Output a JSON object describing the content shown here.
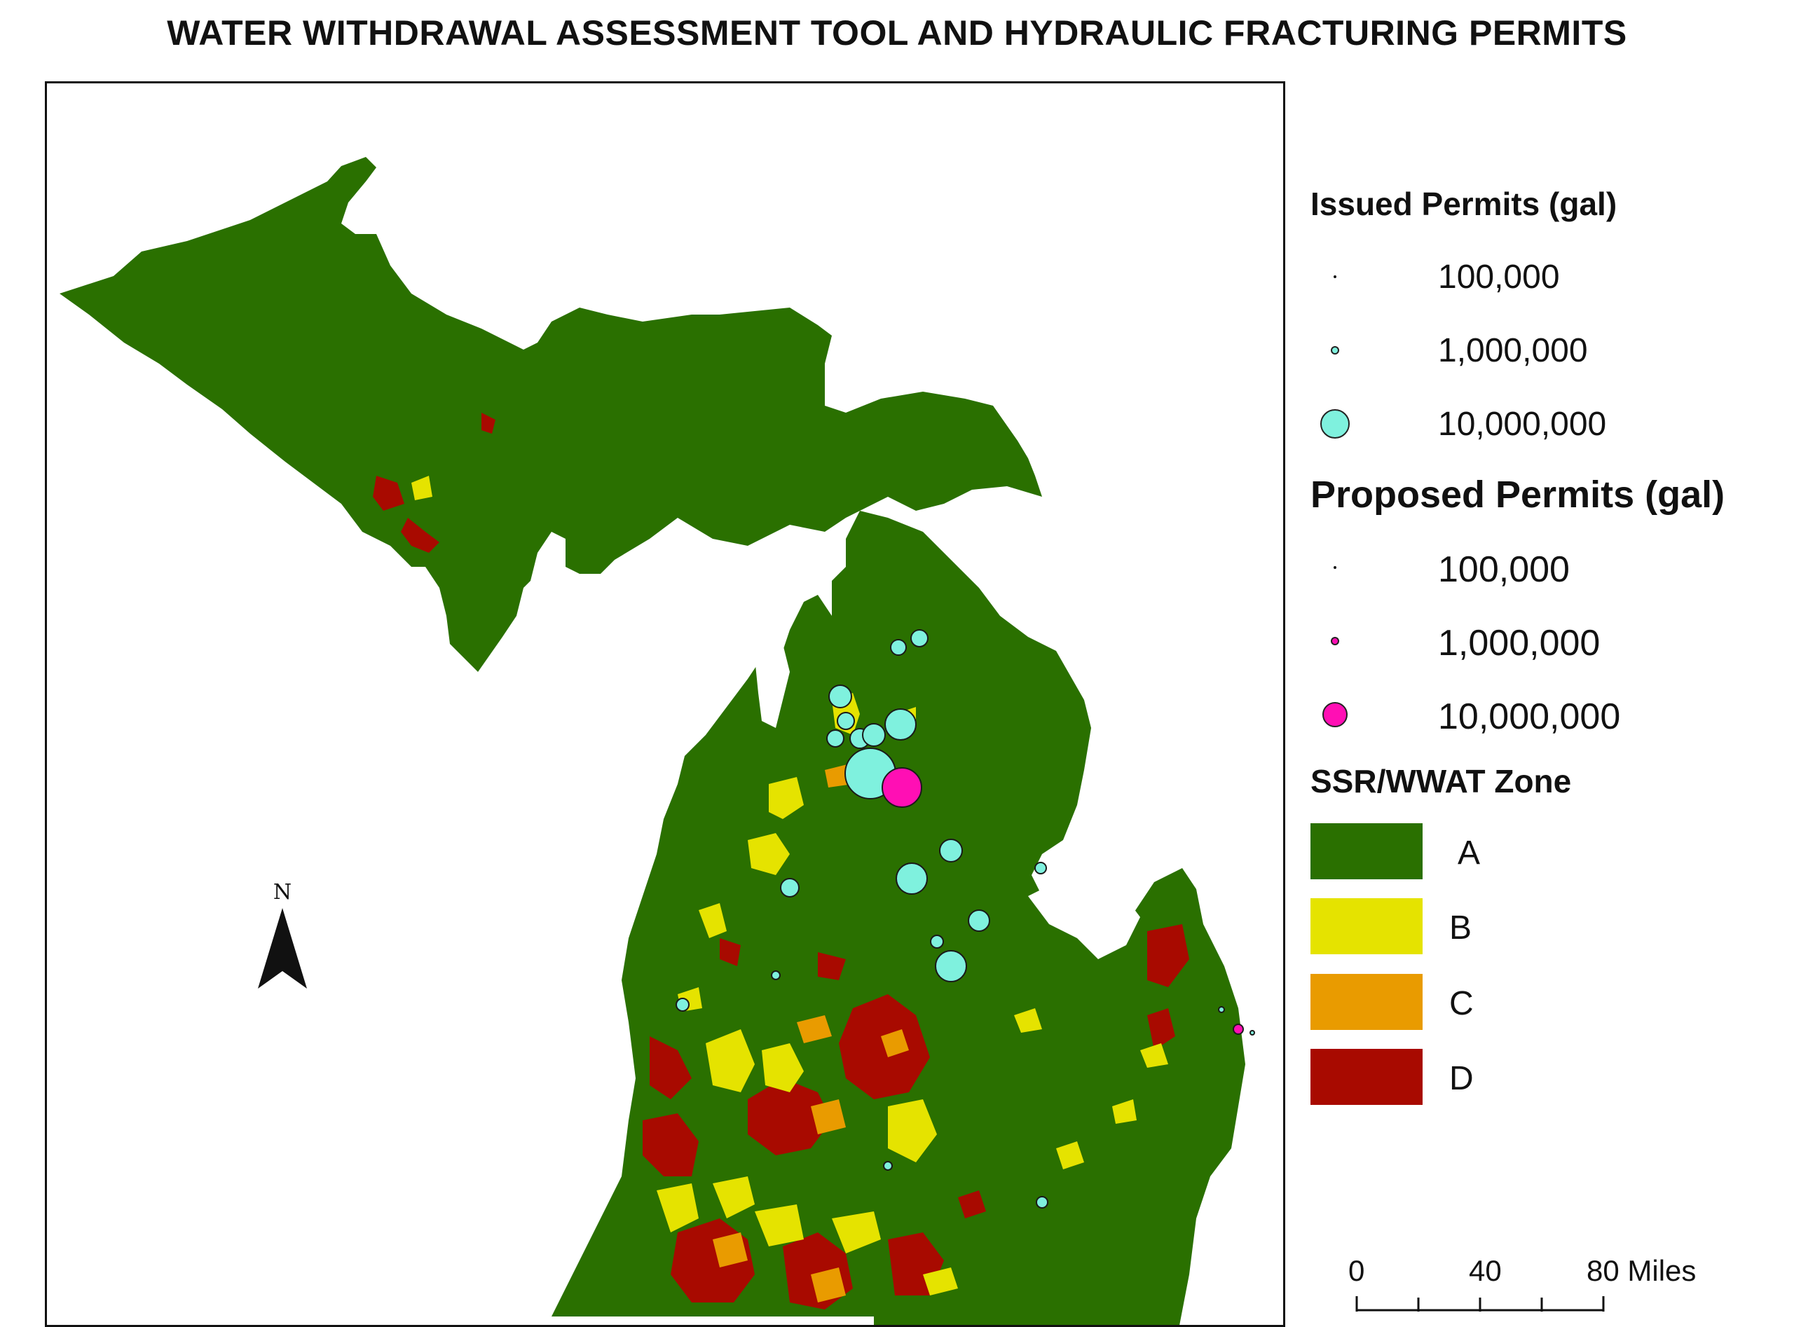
{
  "title": "WATER WITHDRAWAL ASSESSMENT TOOL AND HYDRAULIC FRACTURING PERMITS",
  "colors": {
    "zone_A": "#2a7000",
    "zone_B": "#e5e300",
    "zone_C": "#e99b00",
    "zone_D": "#a80a00",
    "issued": "#7ff1de",
    "proposed": "#ff0fb4"
  },
  "legend": {
    "issued": {
      "heading": "Issued Permits (gal)",
      "items": [
        {
          "label": "100,000"
        },
        {
          "label": "1,000,000"
        },
        {
          "label": "10,000,000"
        }
      ]
    },
    "proposed": {
      "heading": "Proposed Permits (gal)",
      "items": [
        {
          "label": "100,000"
        },
        {
          "label": "1,000,000"
        },
        {
          "label": "10,000,000"
        }
      ]
    },
    "zones": {
      "heading": "SSR/WWAT Zone",
      "items": [
        {
          "label": "A"
        },
        {
          "label": "B"
        },
        {
          "label": "C"
        },
        {
          "label": "D"
        }
      ]
    }
  },
  "north_arrow": {
    "letter": "N"
  },
  "scale_bar": {
    "labels": [
      "0",
      "40",
      "80 Miles"
    ]
  }
}
